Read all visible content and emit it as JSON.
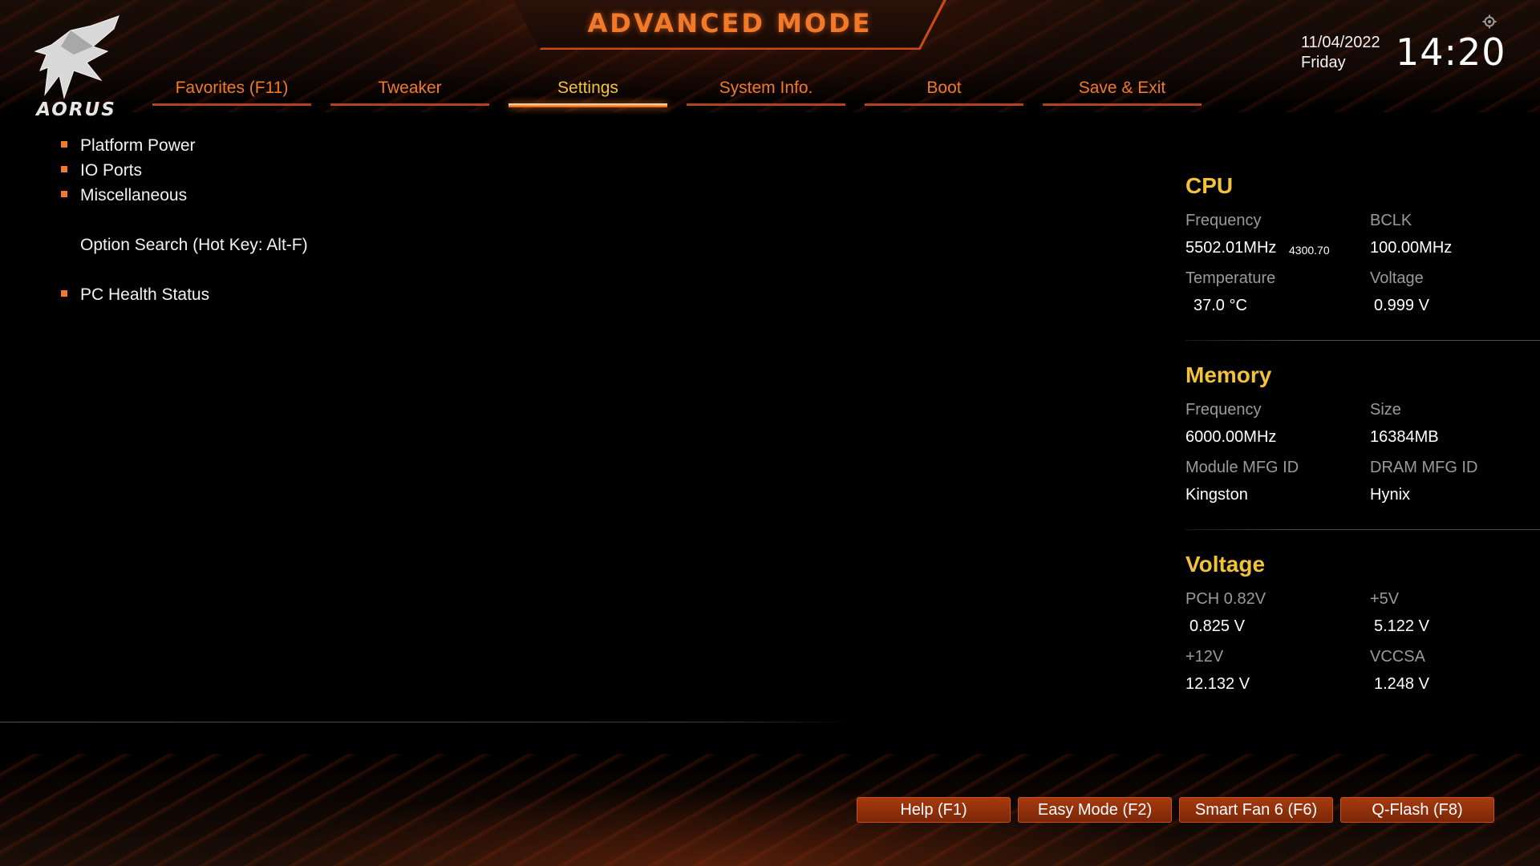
{
  "header": {
    "title": "ADVANCED MODE",
    "brand": "AORUS",
    "date": "11/04/2022",
    "day": "Friday",
    "time": "14:20"
  },
  "tabs": [
    {
      "label": "Favorites (F11)",
      "active": false
    },
    {
      "label": "Tweaker",
      "active": false
    },
    {
      "label": "Settings",
      "active": true
    },
    {
      "label": "System Info.",
      "active": false
    },
    {
      "label": "Boot",
      "active": false
    },
    {
      "label": "Save & Exit",
      "active": false
    }
  ],
  "menu": {
    "items": [
      {
        "label": "Platform Power",
        "bullet": true
      },
      {
        "label": "IO Ports",
        "bullet": true
      },
      {
        "label": "Miscellaneous",
        "bullet": true
      },
      {
        "label": "Option Search (Hot Key: Alt-F)",
        "bullet": false
      },
      {
        "label": "PC Health Status",
        "bullet": true
      }
    ]
  },
  "info": {
    "cpu": {
      "title": "CPU",
      "frequency_label": "Frequency",
      "frequency_value": "5502.01MHz",
      "frequency_sub": "4300.70",
      "bclk_label": "BCLK",
      "bclk_value": "100.00MHz",
      "temperature_label": "Temperature",
      "temperature_value": "37.0 °C",
      "voltage_label": "Voltage",
      "voltage_value": "0.999 V"
    },
    "memory": {
      "title": "Memory",
      "frequency_label": "Frequency",
      "frequency_value": "6000.00MHz",
      "size_label": "Size",
      "size_value": "16384MB",
      "module_label": "Module MFG ID",
      "module_value": "Kingston",
      "dram_label": "DRAM MFG ID",
      "dram_value": "Hynix"
    },
    "voltage": {
      "title": "Voltage",
      "pch_label": "PCH 0.82V",
      "pch_value": "0.825 V",
      "v5_label": "+5V",
      "v5_value": "5.122 V",
      "v12_label": "+12V",
      "v12_value": "12.132 V",
      "vccsa_label": "VCCSA",
      "vccsa_value": "1.248 V"
    }
  },
  "footer": {
    "help": "Help (F1)",
    "easy_mode": "Easy Mode (F2)",
    "smart_fan": "Smart Fan 6 (F6)",
    "qflash": "Q-Flash (F8)"
  },
  "colors": {
    "accent": "#f07a2a",
    "active_tab": "#f2c23a",
    "section_title": "#f2c23a",
    "button": "#a83a0e"
  }
}
